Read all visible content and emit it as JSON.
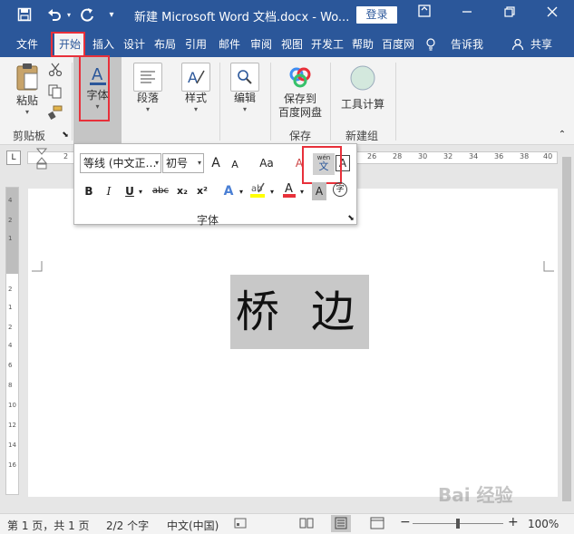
{
  "titlebar": {
    "title": "新建 Microsoft Word 文档.docx  -  Wo...",
    "login": "登录",
    "save_icon": "save-icon",
    "undo_icon": "undo-icon",
    "redo_icon": "redo-icon",
    "customize_icon": "customize-qat-icon"
  },
  "tabs": [
    "文件",
    "开始",
    "插入",
    "设计",
    "布局",
    "引用",
    "邮件",
    "审阅",
    "视图",
    "开发工",
    "帮助",
    "百度网"
  ],
  "tell_me": "告诉我",
  "share": "共享",
  "ribbon": {
    "paste": "粘贴",
    "clipboard_group": "剪贴板",
    "font_btn": "字体",
    "paragraph_btn": "段落",
    "styles_btn": "样式",
    "editing_btn": "编辑",
    "save_baidu_line1": "保存到",
    "save_baidu_line2": "百度网盘",
    "save_group": "保存",
    "tool_calc": "工具计算",
    "new_group": "新建组"
  },
  "font_popup": {
    "font_name": "等线 (中文正…",
    "font_size": "初号",
    "grow": "A",
    "shrink": "A",
    "case": "Aa",
    "bold": "B",
    "italic": "I",
    "underline": "U",
    "strike": "abc",
    "subscript": "x₂",
    "superscript": "x²",
    "phonetic_top": "wén",
    "phonetic_bottom": "文",
    "group_label": "字体",
    "enclose": "字"
  },
  "ruler": {
    "numbers": [
      "2",
      "26",
      "28",
      "30",
      "32",
      "34",
      "36",
      "38",
      "40"
    ],
    "vnumbers": [
      "4",
      "2",
      "1",
      "2",
      "1",
      "2",
      "4",
      "6",
      "8",
      "10",
      "12",
      "14",
      "16"
    ]
  },
  "document": {
    "text": "桥 边"
  },
  "statusbar": {
    "page": "第 1 页，共 1 页",
    "words": "2/2 个字",
    "lang": "中文(中国)",
    "zoom": "100%"
  },
  "colors": {
    "accent": "#2b579a",
    "highlight": "#e8303a"
  },
  "watermark": "Bai 经验"
}
